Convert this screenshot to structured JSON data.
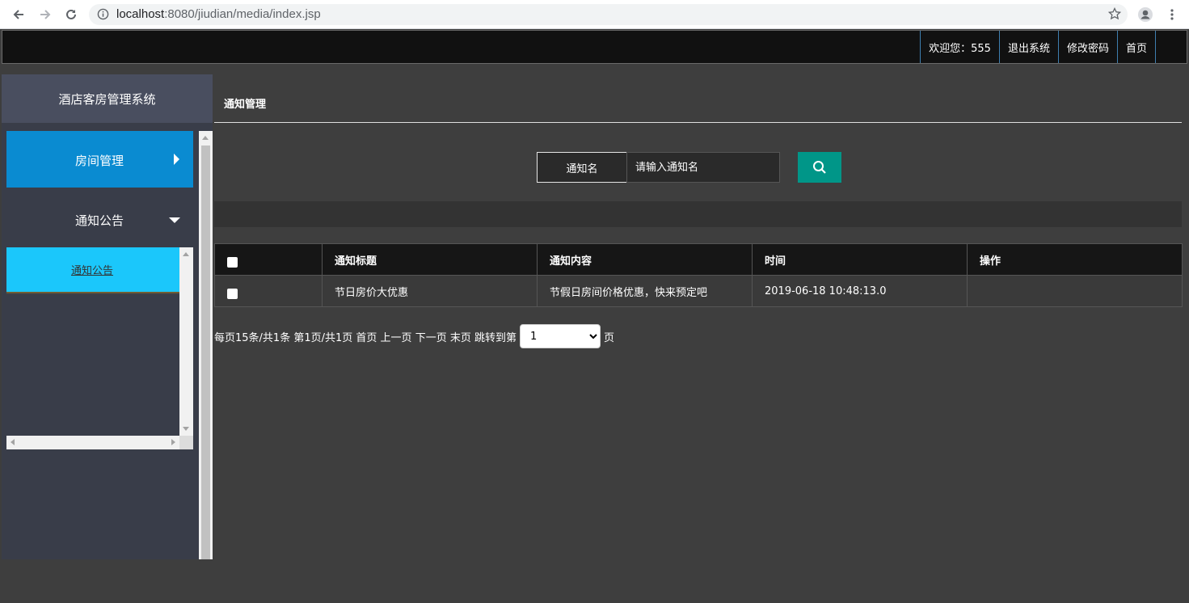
{
  "browser": {
    "url_host": "localhost",
    "url_rest": ":8080/jiudian/media/index.jsp"
  },
  "topnav": {
    "welcome": "欢迎您：555",
    "logout": "退出系统",
    "change_password": "修改密码",
    "home": "首页"
  },
  "sidebar": {
    "title": "酒店客房管理系统",
    "menu": [
      {
        "label": "房间管理",
        "active": true
      },
      {
        "label": "通知公告",
        "expanded": true
      }
    ],
    "submenu": [
      {
        "label": "通知公告"
      }
    ]
  },
  "main": {
    "page_title": "通知管理",
    "search": {
      "label": "通知名",
      "placeholder": "请输入通知名"
    },
    "table": {
      "headers": [
        "通知标题",
        "通知内容",
        "时间",
        "操作"
      ],
      "rows": [
        {
          "title": "节日房价大优惠",
          "content": "节假日房间价格优惠，快来预定吧",
          "time": "2019-06-18 10:48:13.0",
          "actions": ""
        }
      ]
    },
    "pager": {
      "summary": "每页15条/共1条 第1页/共1页",
      "first": "首页",
      "prev": "上一页",
      "next": "下一页",
      "last": "末页",
      "jump_label": "跳转到第",
      "selected_page": "1",
      "page_suffix": "页"
    }
  },
  "colors": {
    "accent_blue": "#0a8bd1",
    "sub_active": "#1bc7fb",
    "search_button": "#009688"
  }
}
